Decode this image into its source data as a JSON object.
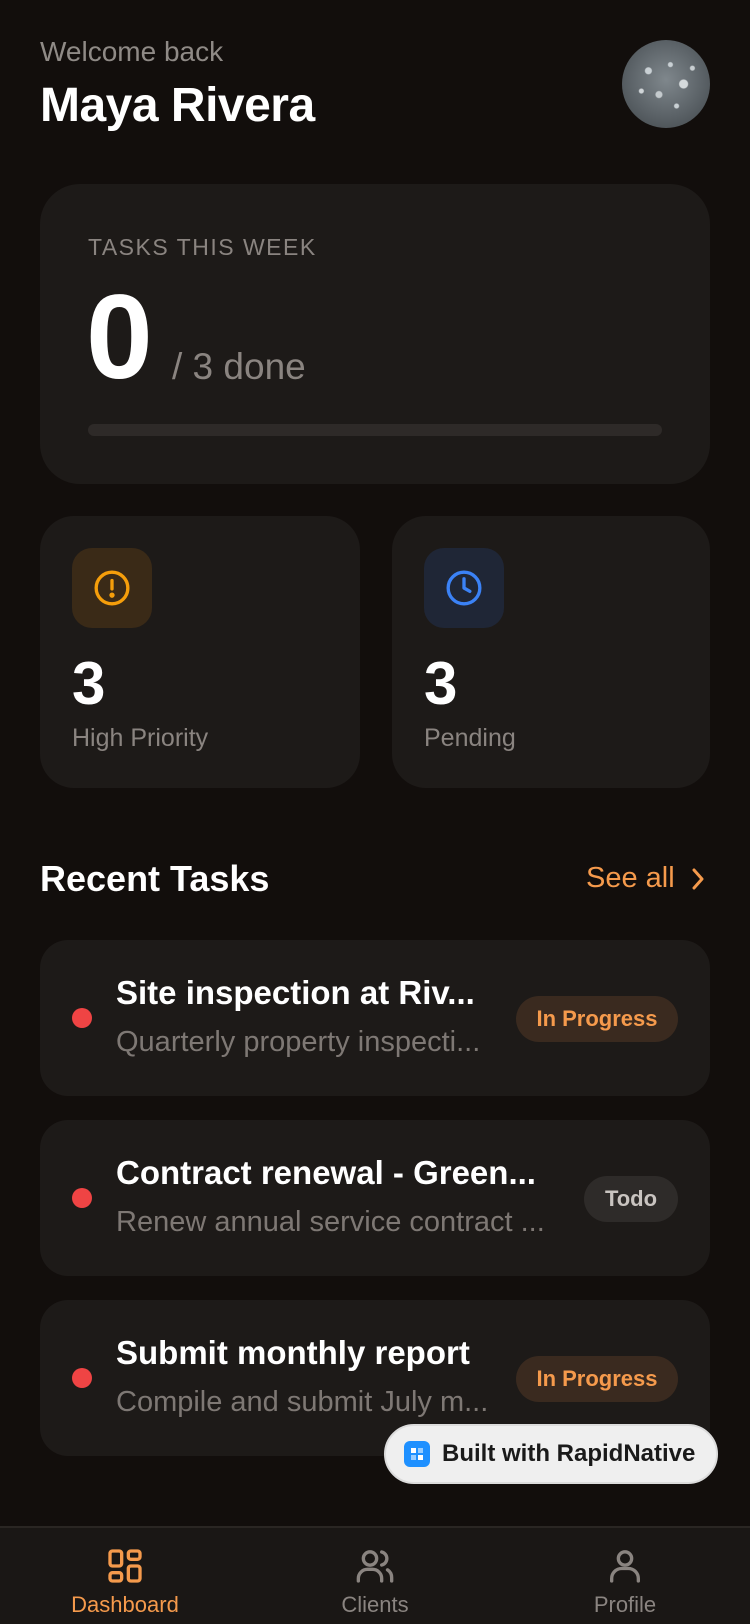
{
  "header": {
    "welcome": "Welcome back",
    "name": "Maya Rivera"
  },
  "weekly": {
    "label": "TASKS THIS WEEK",
    "done": "0",
    "total_text": "/ 3 done",
    "progress_fraction": 0
  },
  "stats": [
    {
      "value": "3",
      "label": "High Priority",
      "icon": "alert-circle-icon",
      "color": "#f59e0b"
    },
    {
      "value": "3",
      "label": "Pending",
      "icon": "clock-icon",
      "color": "#3b82f6"
    }
  ],
  "recent": {
    "title": "Recent Tasks",
    "see_all": "See all",
    "tasks": [
      {
        "title": "Site inspection at Riv...",
        "description": "Quarterly property inspecti...",
        "status": "In Progress"
      },
      {
        "title": "Contract renewal - Green...",
        "description": "Renew annual service contract ...",
        "status": "Todo"
      },
      {
        "title": "Submit monthly report",
        "description": "Compile and submit July m...",
        "status": "In Progress"
      }
    ]
  },
  "built_with": "Built with RapidNative",
  "nav": {
    "dashboard": "Dashboard",
    "clients": "Clients",
    "profile": "Profile"
  },
  "colors": {
    "accent": "#f59a4c",
    "priority_dot": "#ef4444",
    "background": "#120e0c",
    "card": "#1d1a18"
  }
}
